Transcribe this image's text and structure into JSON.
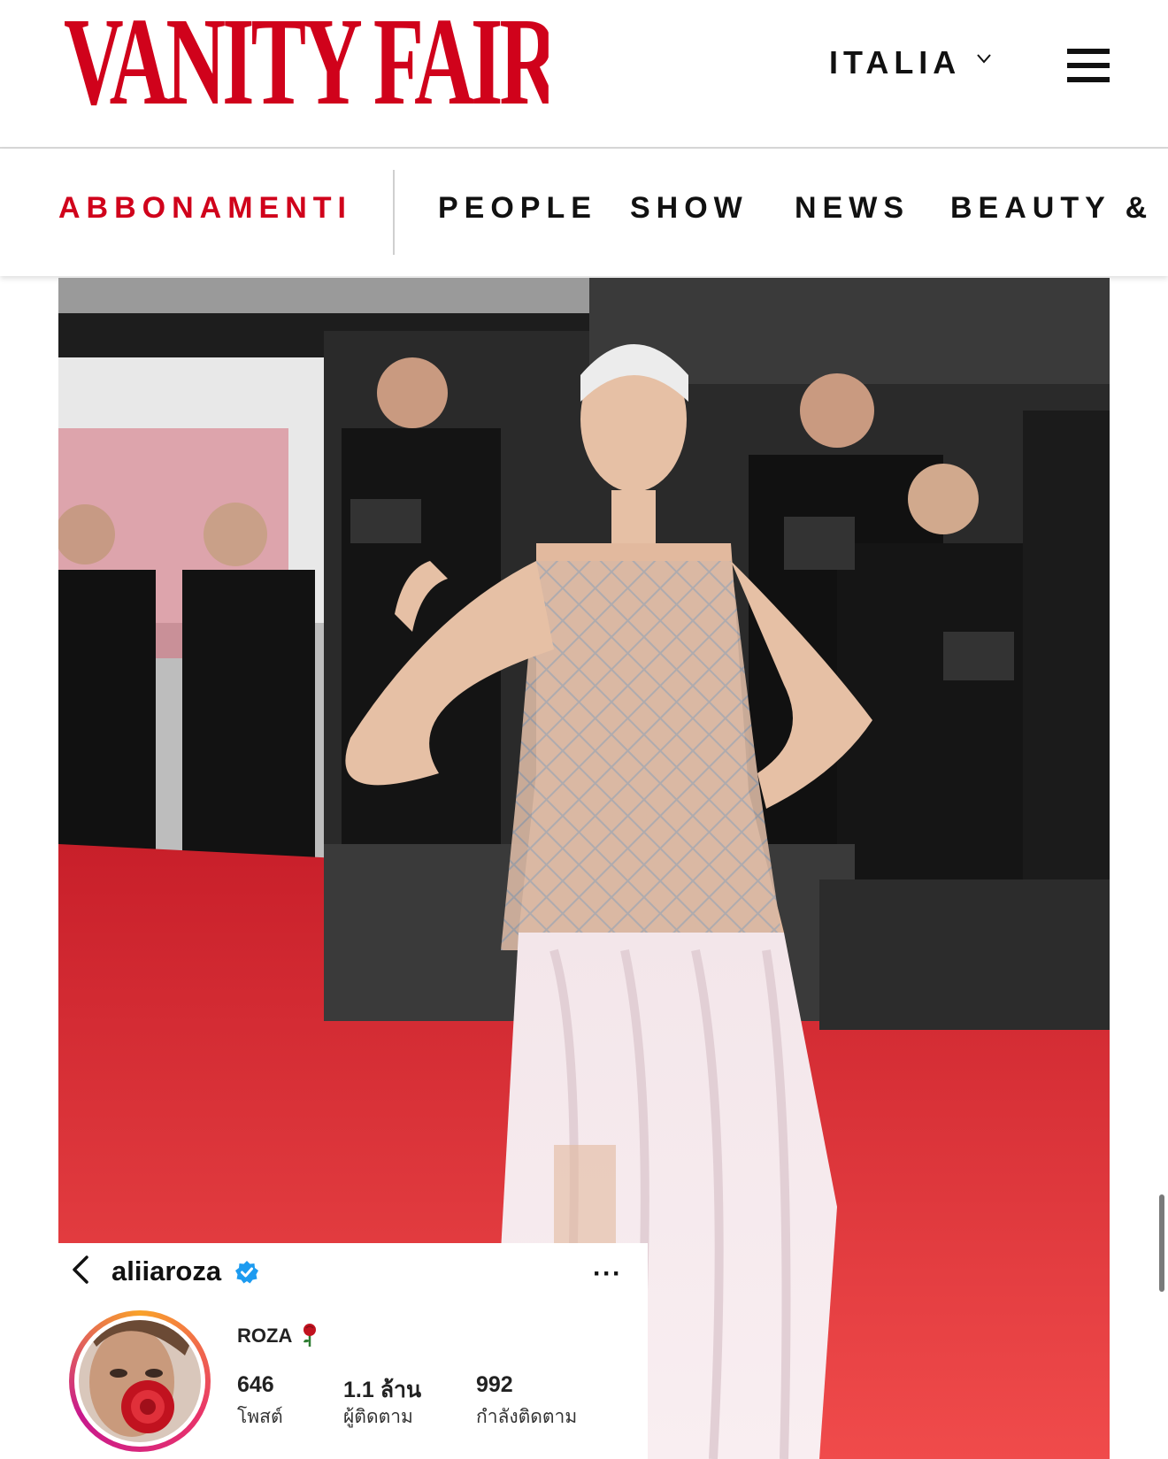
{
  "header": {
    "logo_text": "VANITY FAIR",
    "edition": "ITALIA",
    "brand_color": "#d0021b"
  },
  "nav": {
    "items": [
      {
        "label": "ABBONAMENTI",
        "color": "#d0021b"
      },
      {
        "label": "PEOPLE",
        "color": "#111111"
      },
      {
        "label": "SHOW",
        "color": "#111111"
      },
      {
        "label": "NEWS",
        "color": "#111111"
      },
      {
        "label": "BEAUTY &",
        "color": "#111111"
      }
    ]
  },
  "profile": {
    "username": "aliiaroza",
    "more_label": "···",
    "name": "ROZA",
    "stats": [
      {
        "value": "646",
        "label": "โพสต์"
      },
      {
        "value": "1.1 ล้าน",
        "label": "ผู้ติดตาม"
      },
      {
        "value": "992",
        "label": "กำลังติดตาม"
      }
    ]
  },
  "icons": {
    "edition_dropdown": "chevron-down-icon",
    "menu": "hamburger-menu-icon",
    "back": "chevron-left-icon",
    "verified": "verified-badge-icon",
    "name_emoji": "rose-icon"
  }
}
